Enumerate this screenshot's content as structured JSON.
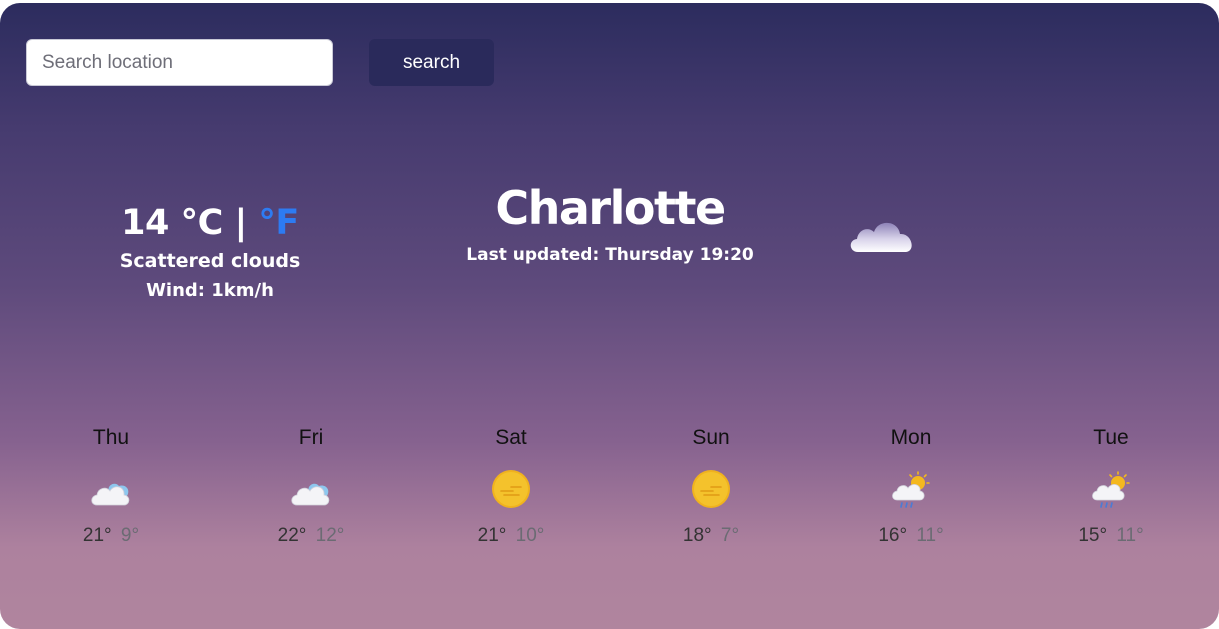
{
  "search": {
    "placeholder": "Search location",
    "button_label": "search"
  },
  "current": {
    "temp": "14",
    "unit_c": "°C",
    "separator": "|",
    "unit_f": "°F",
    "condition": "Scattered clouds",
    "wind": "Wind: 1km/h",
    "icon": "cloud-icon"
  },
  "location": {
    "city": "Charlotte",
    "last_updated": "Last updated: Thursday 19:20"
  },
  "forecast": [
    {
      "day": "Thu",
      "icon": "cloudy-icon",
      "max": "21°",
      "min": "9°"
    },
    {
      "day": "Fri",
      "icon": "cloudy-icon",
      "max": "22°",
      "min": "12°"
    },
    {
      "day": "Sat",
      "icon": "sun-haze-icon",
      "max": "21°",
      "min": "10°"
    },
    {
      "day": "Sun",
      "icon": "sun-haze-icon",
      "max": "18°",
      "min": "7°"
    },
    {
      "day": "Mon",
      "icon": "sun-cloud-rain-icon",
      "max": "16°",
      "min": "11°"
    },
    {
      "day": "Tue",
      "icon": "sun-cloud-rain-icon",
      "max": "15°",
      "min": "11°"
    }
  ],
  "colors": {
    "gradient_top": "#2c2c5e",
    "gradient_bottom": "#b0859e",
    "button_bg": "#2a2a5b",
    "fahrenheit_link": "#2d7bf2"
  }
}
